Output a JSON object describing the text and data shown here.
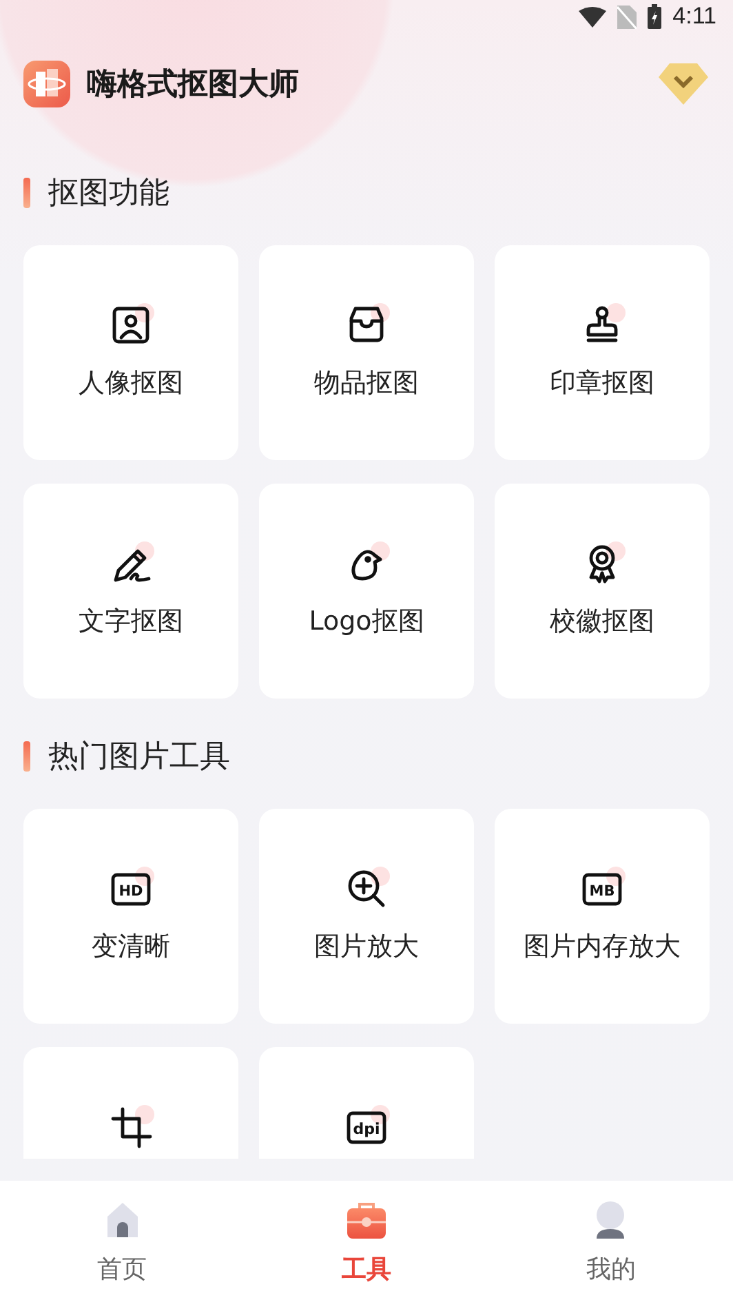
{
  "status_bar": {
    "time": "4:11"
  },
  "app": {
    "title": "嗨格式抠图大师"
  },
  "sections": [
    {
      "title": "抠图功能",
      "tools": [
        {
          "label": "人像抠图",
          "kind": "portrait"
        },
        {
          "label": "物品抠图",
          "kind": "tray"
        },
        {
          "label": "印章抠图",
          "kind": "stamp"
        },
        {
          "label": "文字抠图",
          "kind": "pen"
        },
        {
          "label": "Logo抠图",
          "kind": "bird"
        },
        {
          "label": "校徽抠图",
          "kind": "medal"
        }
      ]
    },
    {
      "title": "热门图片工具",
      "tools": [
        {
          "label": "变清晰",
          "kind": "badge",
          "badge": "HD"
        },
        {
          "label": "图片放大",
          "kind": "zoom"
        },
        {
          "label": "图片内存放大",
          "kind": "badge",
          "badge": "MB"
        },
        {
          "kind": "crop"
        },
        {
          "kind": "badge",
          "badge": "dpi"
        }
      ]
    }
  ],
  "nav": [
    {
      "label": "首页",
      "kind": "home",
      "selected": false
    },
    {
      "label": "工具",
      "kind": "toolbox",
      "selected": true
    },
    {
      "label": "我的",
      "kind": "person",
      "selected": false
    }
  ]
}
